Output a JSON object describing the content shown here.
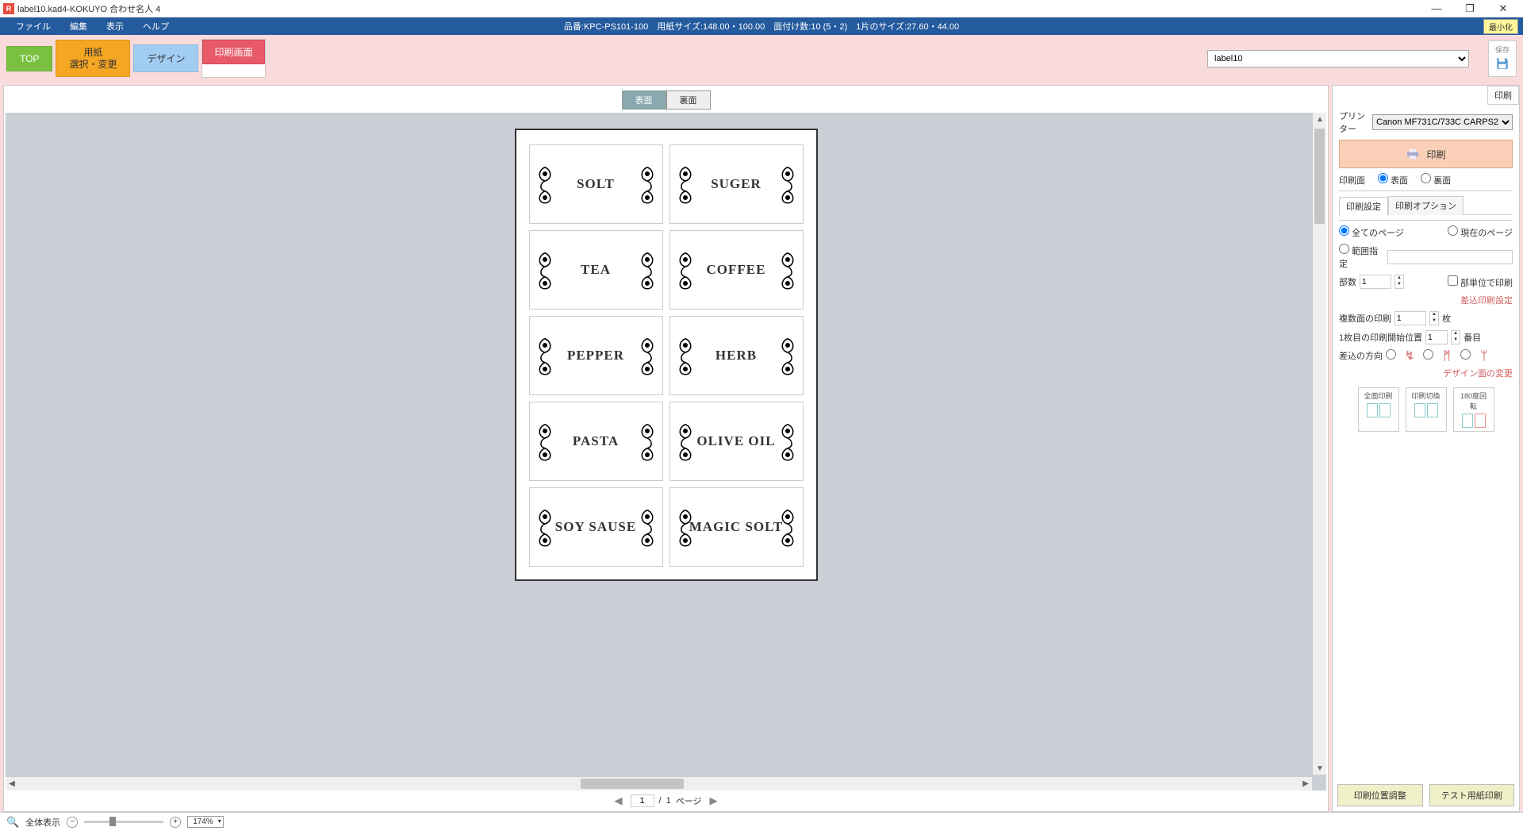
{
  "window_title": "label10.kad4-KOKUYO 合わせ名人 4",
  "menu": {
    "file": "ファイル",
    "edit": "編集",
    "view": "表示",
    "help": "ヘルプ"
  },
  "info_strip": "品番:KPC-PS101-100　用紙サイズ:148.00・100.00　面付け数:10 (5・2)　1片のサイズ:27.60・44.00",
  "minimize_badge": "最小化",
  "main_tabs": {
    "top": "TOP",
    "paper": "用紙\n選択・変更",
    "design": "デザイン",
    "print": "印刷画面"
  },
  "filename": "label10",
  "save_label": "保存",
  "canvas_tabs": {
    "front": "表面",
    "back": "裏面"
  },
  "labels": [
    "SOLT",
    "SUGER",
    "TEA",
    "COFFEE",
    "PEPPER",
    "HERB",
    "PASTA",
    "OLIVE OIL",
    "SOY SAUSE",
    "MAGIC SOLT"
  ],
  "pager": {
    "current": "1",
    "sep": "/",
    "total": "1",
    "unit": "ページ"
  },
  "side": {
    "tab": "印刷",
    "printer_label": "プリンター",
    "printer_value": "Canon MF731C/733C CARPS2",
    "print_button": "印刷",
    "face_label": "印刷面",
    "face_front": "表面",
    "face_back": "裏面",
    "subtabs": {
      "settings": "印刷設定",
      "options": "印刷オプション"
    },
    "pages_all": "全てのページ",
    "pages_current": "現在のページ",
    "pages_range": "範囲指定",
    "copies_label": "部数",
    "copies_value": "1",
    "per_set": "部単位で印刷",
    "merge_settings": "差込印刷設定",
    "multi_label": "複数面の印刷",
    "multi_value": "1",
    "multi_unit": "枚",
    "start_label": "1枚目の印刷開始位置",
    "start_value": "1",
    "start_unit": "番目",
    "dir_label": "差込の方向",
    "change_design": "デザイン面の変更",
    "opts": {
      "full": "全面印刷",
      "switch": "印刷切換",
      "rotate": "180度回転"
    },
    "pos_adjust": "印刷位置調整",
    "test_print": "テスト用紙印刷"
  },
  "status": {
    "fit": "全体表示",
    "zoom": "174%"
  }
}
